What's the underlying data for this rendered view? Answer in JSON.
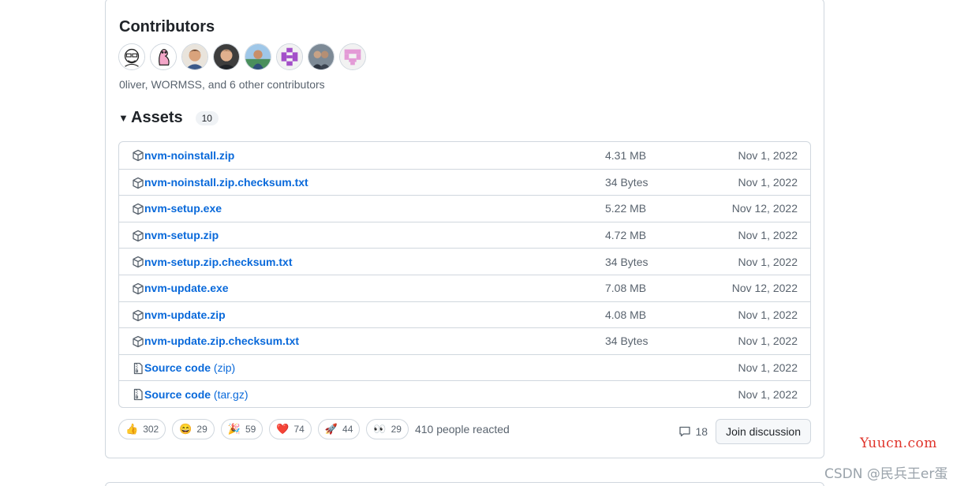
{
  "contributors": {
    "title": "Contributors",
    "summary": "0liver, WORMSS, and 6 other contributors",
    "avatars": [
      {
        "icon": "sketch-face-avatar"
      },
      {
        "icon": "pink-worm-avatar"
      },
      {
        "icon": "man-photo-avatar"
      },
      {
        "icon": "man-photo-avatar"
      },
      {
        "icon": "outdoor-photo-avatar"
      },
      {
        "icon": "purple-identicon-avatar"
      },
      {
        "icon": "group-photo-avatar"
      },
      {
        "icon": "pink-identicon-avatar"
      }
    ]
  },
  "assets": {
    "title": "Assets",
    "count": "10",
    "items": [
      {
        "name": "nvm-noinstall.zip",
        "size": "4.31 MB",
        "date": "Nov 1, 2022",
        "icon": "package-icon"
      },
      {
        "name": "nvm-noinstall.zip.checksum.txt",
        "size": "34 Bytes",
        "date": "Nov 1, 2022",
        "icon": "package-icon"
      },
      {
        "name": "nvm-setup.exe",
        "size": "5.22 MB",
        "date": "Nov 12, 2022",
        "icon": "package-icon"
      },
      {
        "name": "nvm-setup.zip",
        "size": "4.72 MB",
        "date": "Nov 1, 2022",
        "icon": "package-icon"
      },
      {
        "name": "nvm-setup.zip.checksum.txt",
        "size": "34 Bytes",
        "date": "Nov 1, 2022",
        "icon": "package-icon"
      },
      {
        "name": "nvm-update.exe",
        "size": "7.08 MB",
        "date": "Nov 12, 2022",
        "icon": "package-icon"
      },
      {
        "name": "nvm-update.zip",
        "size": "4.08 MB",
        "date": "Nov 1, 2022",
        "icon": "package-icon"
      },
      {
        "name": "nvm-update.zip.checksum.txt",
        "size": "34 Bytes",
        "date": "Nov 1, 2022",
        "icon": "package-icon"
      }
    ],
    "sources": [
      {
        "name": "Source code",
        "ext": "(zip)",
        "date": "Nov 1, 2022",
        "icon": "file-zip-icon"
      },
      {
        "name": "Source code",
        "ext": "(tar.gz)",
        "date": "Nov 1, 2022",
        "icon": "file-zip-icon"
      }
    ]
  },
  "reactions": {
    "items": [
      {
        "emoji": "👍",
        "count": "302",
        "icon": "thumbs-up-icon"
      },
      {
        "emoji": "😄",
        "count": "29",
        "icon": "smile-icon"
      },
      {
        "emoji": "🎉",
        "count": "59",
        "icon": "tada-icon"
      },
      {
        "emoji": "❤️",
        "count": "74",
        "icon": "heart-icon"
      },
      {
        "emoji": "🚀",
        "count": "44",
        "icon": "rocket-icon"
      },
      {
        "emoji": "👀",
        "count": "29",
        "icon": "eyes-icon"
      }
    ],
    "summary": "410 people reacted"
  },
  "discussion": {
    "comment_count": "18",
    "join_label": "Join discussion"
  },
  "watermarks": {
    "site": "Yuucn.com",
    "author": "CSDN @民兵王er蛋"
  },
  "colors": {
    "link": "#0969da",
    "muted": "#59636e",
    "border": "#d0d7de",
    "watermark_red": "#e0332a"
  }
}
